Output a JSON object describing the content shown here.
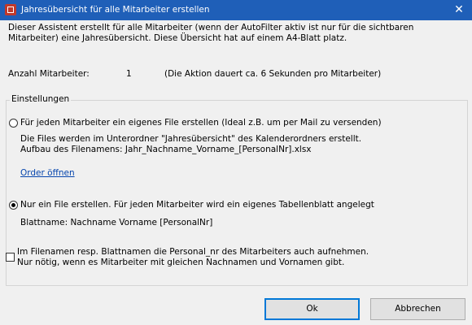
{
  "window": {
    "title": "Jahresübersicht für alle Mitarbeiter erstellen",
    "close_label": "✕"
  },
  "description": "Dieser Assistent erstellt für alle Mitarbeiter (wenn der AutoFilter aktiv ist nur für die sichtbaren Mitarbeiter) eine Jahresübersicht. Diese Übersicht hat auf einem A4-Blatt platz.",
  "employee_count": {
    "label": "Anzahl Mitarbeiter:",
    "value": "1",
    "note": "(Die Aktion dauert ca. 6 Sekunden pro Mitarbeiter)"
  },
  "settings": {
    "legend": "Einstellungen",
    "option_separate_files": {
      "label": "Für jeden Mitarbeiter ein eigenes File erstellen (Ideal z.B. um per Mail zu versenden)",
      "checked": false,
      "info_line1": "Die Files werden im Unterordner \"Jahresübersicht\" des Kalenderordners erstellt.",
      "info_line2": "Aufbau des Filenamens: Jahr_Nachname_Vorname_[PersonalNr].xlsx",
      "link": "Order öffnen"
    },
    "option_single_file": {
      "label": "Nur ein File erstellen. Für jeden Mitarbeiter wird ein eigenes Tabellenblatt angelegt",
      "checked": true,
      "sheet_name": "Blattname: Nachname Vorname [PersonalNr]"
    },
    "include_personal_nr": {
      "line1": "Im Filenamen resp. Blattnamen die Personal_nr des Mitarbeiters auch aufnehmen.",
      "line2": "Nur nötig, wenn es Mitarbeiter mit gleichen Nachnamen und Vornamen gibt.",
      "checked": false
    }
  },
  "buttons": {
    "ok": "Ok",
    "cancel": "Abbrechen"
  }
}
